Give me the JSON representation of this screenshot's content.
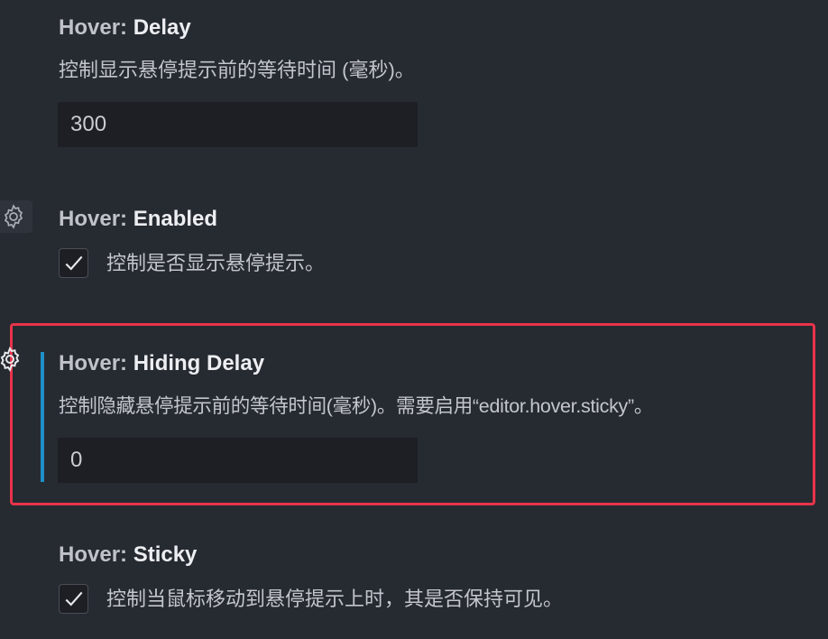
{
  "settings": [
    {
      "category": "Hover: ",
      "name": "Delay",
      "description": "控制显示悬停提示前的等待时间 (毫秒)。",
      "value": "300"
    },
    {
      "category": "Hover: ",
      "name": "Enabled",
      "description": "控制是否显示悬停提示。",
      "checked": true
    },
    {
      "category": "Hover: ",
      "name": "Hiding Delay",
      "description": "控制隐藏悬停提示前的等待时间(毫秒)。需要启用“editor.hover.sticky”。",
      "value": "0"
    },
    {
      "category": "Hover: ",
      "name": "Sticky",
      "description": "控制当鼠标移动到悬停提示上时，其是否保持可见。",
      "checked": true
    }
  ],
  "icons": {
    "gear": "gear-icon",
    "check": "check-icon"
  },
  "colors": {
    "background": "#262a31",
    "highlight_border": "#e8344b",
    "modified_indicator": "#1e8fc7",
    "input_background": "#1d1f24"
  }
}
